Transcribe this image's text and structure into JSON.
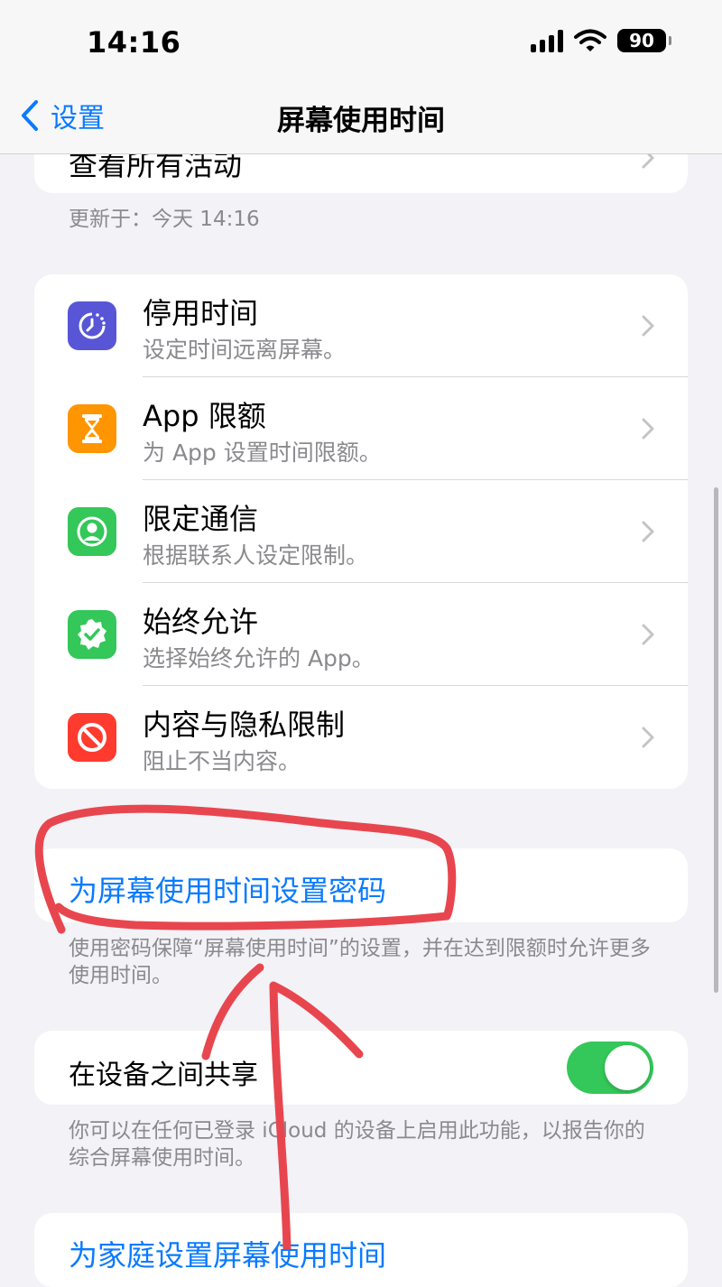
{
  "status_bar": {
    "time": "14:16",
    "battery": "90"
  },
  "nav": {
    "back_label": "设置",
    "title": "屏幕使用时间"
  },
  "activity": {
    "see_all_label": "查看所有活动",
    "updated_text": "更新于：今天 14:16"
  },
  "settings_items": [
    {
      "title": "停用时间",
      "subtitle": "设定时间远离屏幕。",
      "icon": "downtime-icon",
      "color": "#5856d6"
    },
    {
      "title": "App 限额",
      "subtitle": "为 App 设置时间限额。",
      "icon": "hourglass-icon",
      "color": "#ff9500"
    },
    {
      "title": "限定通信",
      "subtitle": "根据联系人设定限制。",
      "icon": "contact-icon",
      "color": "#34c759"
    },
    {
      "title": "始终允许",
      "subtitle": "选择始终允许的 App。",
      "icon": "checkmark-badge-icon",
      "color": "#34c759"
    },
    {
      "title": "内容与隐私限制",
      "subtitle": "阻止不当内容。",
      "icon": "prohibited-icon",
      "color": "#ff3b30"
    }
  ],
  "passcode": {
    "label": "为屏幕使用时间设置密码",
    "footer": "使用密码保障“屏幕使用时间”的设置，并在达到限额时允许更多使用时间。"
  },
  "share": {
    "label": "在设备之间共享",
    "toggle_on": true,
    "footer": "你可以在任何已登录 iCloud 的设备上启用此功能，以报告你的综合屏幕使用时间。"
  },
  "family": {
    "label": "为家庭设置屏幕使用时间"
  },
  "colors": {
    "accent": "#0a7aff",
    "toggle_on": "#34c759",
    "annotation": "#e8464e"
  }
}
